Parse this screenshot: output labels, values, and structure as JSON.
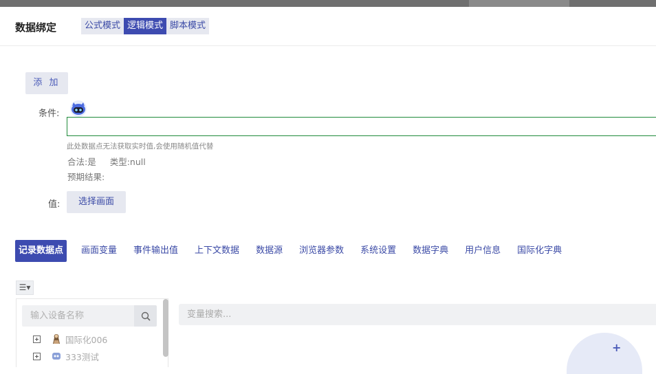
{
  "header": {
    "title": "数据绑定",
    "modes": [
      {
        "label": "公式模式",
        "active": false
      },
      {
        "label": "逻辑模式",
        "active": true
      },
      {
        "label": "脚本模式",
        "active": false
      }
    ]
  },
  "add_button": "添 加",
  "condition": {
    "label": "条件:",
    "value": "",
    "hint": "此处数据点无法获取实时值,会使用随机值代替",
    "valid": "合法:是",
    "type": "类型:null",
    "expected": "预期结果:"
  },
  "value_row": {
    "label": "值:",
    "select_button": "选择画面"
  },
  "tabs": [
    {
      "label": "记录数据点",
      "active": true
    },
    {
      "label": "画面变量"
    },
    {
      "label": "事件输出值"
    },
    {
      "label": "上下文数据"
    },
    {
      "label": "数据源"
    },
    {
      "label": "浏览器参数"
    },
    {
      "label": "系统设置"
    },
    {
      "label": "数据字典"
    },
    {
      "label": "用户信息"
    },
    {
      "label": "国际化字典"
    }
  ],
  "menu_icon": "☰▾",
  "device_search": {
    "placeholder": "输入设备名称",
    "icon": "search-icon"
  },
  "tree": [
    {
      "label": "国际化006",
      "icon": "bust-icon"
    },
    {
      "label": "333测试",
      "icon": "robot-icon"
    }
  ],
  "variable_search": {
    "placeholder": "变量搜索..."
  },
  "colors": {
    "accent": "#3d4bb0",
    "input_border": "#1f8a3a",
    "light_btn": "#e6e8f0"
  }
}
